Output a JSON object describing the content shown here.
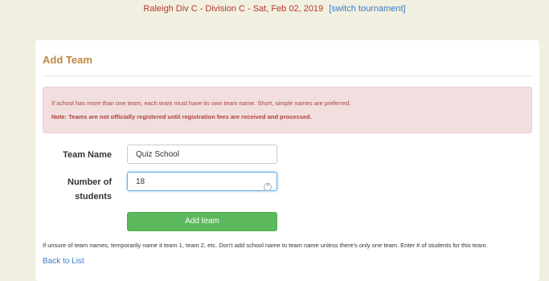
{
  "header": {
    "tournament": "Raleigh Div C - Division C - Sat, Feb 02, 2019",
    "switch_label": "[switch tournament]"
  },
  "panel": {
    "title": "Add Team",
    "alert": {
      "line1": "If school has more than one team, each team must have its own team name. Short, simple names are preferred.",
      "line2": "Note: Teams are not officially registered until registration fees are received and processed."
    },
    "form": {
      "team_name_label": "Team Name",
      "team_name_value": "Quiz School",
      "students_label_1": "Number of",
      "students_label_2": "students",
      "students_value": "18",
      "submit_label": "Add team"
    },
    "help_text": "If unsure of team names, temporarily name it team 1, team 2, etc. Don't add school name to team name unless there's only one team. Enter # of students for this team.",
    "back_label": "Back to List"
  }
}
